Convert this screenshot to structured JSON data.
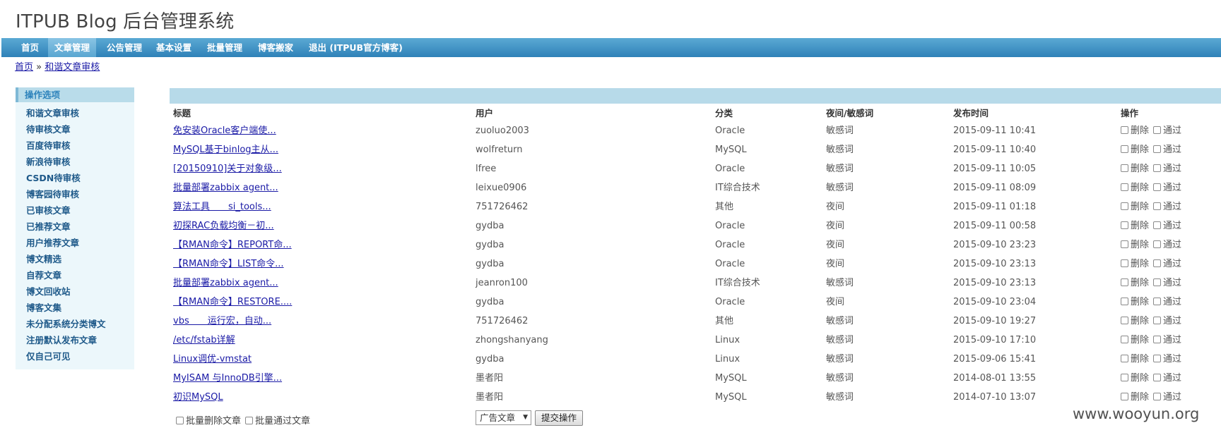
{
  "app": {
    "title": "ITPUB Blog 后台管理系统"
  },
  "nav": {
    "items": [
      {
        "label": "首页"
      },
      {
        "label": "文章管理"
      },
      {
        "label": "公告管理"
      },
      {
        "label": "基本设置"
      },
      {
        "label": "批量管理"
      },
      {
        "label": "博客搬家"
      },
      {
        "label": "退出 (ITPUB官方博客)"
      }
    ],
    "active": "文章管理"
  },
  "breadcrumb": {
    "home": "首页",
    "separator": "»",
    "current": "和谐文章审核"
  },
  "sidebar": {
    "header": "操作选项",
    "items": [
      "和谐文章审核",
      "待审核文章",
      "百度待审核",
      "新浪待审核",
      "CSDN待审核",
      "博客园待审核",
      "已审核文章",
      "已推荐文章",
      "用户推荐文章",
      "博文精选",
      "自荐文章",
      "博文回收站",
      "博客文集",
      "未分配系统分类博文",
      "注册默认发布文章",
      "仅自己可见"
    ]
  },
  "table": {
    "headers": {
      "title": "标题",
      "user": "用户",
      "category": "分类",
      "sensitive": "夜间/敏感词",
      "time": "发布时间",
      "ops": "操作"
    },
    "op_delete": "删除",
    "op_pass": "通过",
    "rows": [
      {
        "title": "免安装Oracle客户端使...",
        "user": "zuoluo2003",
        "category": "Oracle",
        "sensitive": "敏感词",
        "time": "2015-09-11 10:41"
      },
      {
        "title": "MySQL基于binlog主从...",
        "user": "wolfreturn",
        "category": "MySQL",
        "sensitive": "敏感词",
        "time": "2015-09-11 10:40"
      },
      {
        "title": "[20150910]关于对象级...",
        "user": "lfree",
        "category": "Oracle",
        "sensitive": "敏感词",
        "time": "2015-09-11 10:05"
      },
      {
        "title": "批量部署zabbix agent...",
        "user": "leixue0906",
        "category": "IT综合技术",
        "sensitive": "敏感词",
        "time": "2015-09-11 08:09"
      },
      {
        "title": "算法工具　　si_tools...",
        "user": "751726462",
        "category": "其他",
        "sensitive": "夜间",
        "time": "2015-09-11 01:18"
      },
      {
        "title": "初探RAC负载均衡－初...",
        "user": "gydba",
        "category": "Oracle",
        "sensitive": "夜间",
        "time": "2015-09-11 00:58"
      },
      {
        "title": "【RMAN命令】REPORT命...",
        "user": "gydba",
        "category": "Oracle",
        "sensitive": "夜间",
        "time": "2015-09-10 23:23"
      },
      {
        "title": "【RMAN命令】LIST命令...",
        "user": "gydba",
        "category": "Oracle",
        "sensitive": "夜间",
        "time": "2015-09-10 23:13"
      },
      {
        "title": "批量部署zabbix agent...",
        "user": "jeanron100",
        "category": "IT综合技术",
        "sensitive": "敏感词",
        "time": "2015-09-10 23:13"
      },
      {
        "title": "【RMAN命令】RESTORE....",
        "user": "gydba",
        "category": "Oracle",
        "sensitive": "夜间",
        "time": "2015-09-10 23:04"
      },
      {
        "title": "vbs　　运行宏，自动...",
        "user": "751726462",
        "category": "其他",
        "sensitive": "敏感词",
        "time": "2015-09-10 19:27"
      },
      {
        "title": "/etc/fstab详解",
        "user": "zhongshanyang",
        "category": "Linux",
        "sensitive": "敏感词",
        "time": "2015-09-10 17:10"
      },
      {
        "title": "Linux调优-vmstat",
        "user": "gydba",
        "category": "Linux",
        "sensitive": "敏感词",
        "time": "2015-09-06 15:41"
      },
      {
        "title": "MyISAM 与InnoDB引擎...",
        "user": "墨者阳",
        "category": "MySQL",
        "sensitive": "敏感词",
        "time": "2014-08-01 13:55"
      },
      {
        "title": "初识MySQL",
        "user": "墨者阳",
        "category": "MySQL",
        "sensitive": "敏感词",
        "time": "2014-07-10 13:07"
      }
    ]
  },
  "footer": {
    "batch_delete": "批量删除文章",
    "batch_pass": "批量通过文章",
    "select_value": "广告文章",
    "submit": "提交操作"
  },
  "watermark": "www.wooyun.org"
}
